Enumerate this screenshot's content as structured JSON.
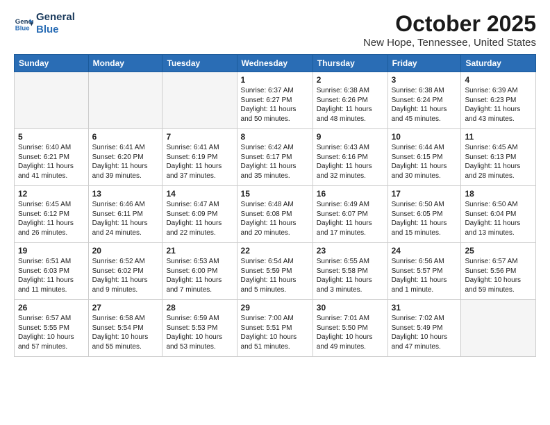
{
  "header": {
    "logo_line1": "General",
    "logo_line2": "Blue",
    "month": "October 2025",
    "location": "New Hope, Tennessee, United States"
  },
  "days_of_week": [
    "Sunday",
    "Monday",
    "Tuesday",
    "Wednesday",
    "Thursday",
    "Friday",
    "Saturday"
  ],
  "weeks": [
    [
      {
        "day": "",
        "info": ""
      },
      {
        "day": "",
        "info": ""
      },
      {
        "day": "",
        "info": ""
      },
      {
        "day": "1",
        "info": "Sunrise: 6:37 AM\nSunset: 6:27 PM\nDaylight: 11 hours\nand 50 minutes."
      },
      {
        "day": "2",
        "info": "Sunrise: 6:38 AM\nSunset: 6:26 PM\nDaylight: 11 hours\nand 48 minutes."
      },
      {
        "day": "3",
        "info": "Sunrise: 6:38 AM\nSunset: 6:24 PM\nDaylight: 11 hours\nand 45 minutes."
      },
      {
        "day": "4",
        "info": "Sunrise: 6:39 AM\nSunset: 6:23 PM\nDaylight: 11 hours\nand 43 minutes."
      }
    ],
    [
      {
        "day": "5",
        "info": "Sunrise: 6:40 AM\nSunset: 6:21 PM\nDaylight: 11 hours\nand 41 minutes."
      },
      {
        "day": "6",
        "info": "Sunrise: 6:41 AM\nSunset: 6:20 PM\nDaylight: 11 hours\nand 39 minutes."
      },
      {
        "day": "7",
        "info": "Sunrise: 6:41 AM\nSunset: 6:19 PM\nDaylight: 11 hours\nand 37 minutes."
      },
      {
        "day": "8",
        "info": "Sunrise: 6:42 AM\nSunset: 6:17 PM\nDaylight: 11 hours\nand 35 minutes."
      },
      {
        "day": "9",
        "info": "Sunrise: 6:43 AM\nSunset: 6:16 PM\nDaylight: 11 hours\nand 32 minutes."
      },
      {
        "day": "10",
        "info": "Sunrise: 6:44 AM\nSunset: 6:15 PM\nDaylight: 11 hours\nand 30 minutes."
      },
      {
        "day": "11",
        "info": "Sunrise: 6:45 AM\nSunset: 6:13 PM\nDaylight: 11 hours\nand 28 minutes."
      }
    ],
    [
      {
        "day": "12",
        "info": "Sunrise: 6:45 AM\nSunset: 6:12 PM\nDaylight: 11 hours\nand 26 minutes."
      },
      {
        "day": "13",
        "info": "Sunrise: 6:46 AM\nSunset: 6:11 PM\nDaylight: 11 hours\nand 24 minutes."
      },
      {
        "day": "14",
        "info": "Sunrise: 6:47 AM\nSunset: 6:09 PM\nDaylight: 11 hours\nand 22 minutes."
      },
      {
        "day": "15",
        "info": "Sunrise: 6:48 AM\nSunset: 6:08 PM\nDaylight: 11 hours\nand 20 minutes."
      },
      {
        "day": "16",
        "info": "Sunrise: 6:49 AM\nSunset: 6:07 PM\nDaylight: 11 hours\nand 17 minutes."
      },
      {
        "day": "17",
        "info": "Sunrise: 6:50 AM\nSunset: 6:05 PM\nDaylight: 11 hours\nand 15 minutes."
      },
      {
        "day": "18",
        "info": "Sunrise: 6:50 AM\nSunset: 6:04 PM\nDaylight: 11 hours\nand 13 minutes."
      }
    ],
    [
      {
        "day": "19",
        "info": "Sunrise: 6:51 AM\nSunset: 6:03 PM\nDaylight: 11 hours\nand 11 minutes."
      },
      {
        "day": "20",
        "info": "Sunrise: 6:52 AM\nSunset: 6:02 PM\nDaylight: 11 hours\nand 9 minutes."
      },
      {
        "day": "21",
        "info": "Sunrise: 6:53 AM\nSunset: 6:00 PM\nDaylight: 11 hours\nand 7 minutes."
      },
      {
        "day": "22",
        "info": "Sunrise: 6:54 AM\nSunset: 5:59 PM\nDaylight: 11 hours\nand 5 minutes."
      },
      {
        "day": "23",
        "info": "Sunrise: 6:55 AM\nSunset: 5:58 PM\nDaylight: 11 hours\nand 3 minutes."
      },
      {
        "day": "24",
        "info": "Sunrise: 6:56 AM\nSunset: 5:57 PM\nDaylight: 11 hours\nand 1 minute."
      },
      {
        "day": "25",
        "info": "Sunrise: 6:57 AM\nSunset: 5:56 PM\nDaylight: 10 hours\nand 59 minutes."
      }
    ],
    [
      {
        "day": "26",
        "info": "Sunrise: 6:57 AM\nSunset: 5:55 PM\nDaylight: 10 hours\nand 57 minutes."
      },
      {
        "day": "27",
        "info": "Sunrise: 6:58 AM\nSunset: 5:54 PM\nDaylight: 10 hours\nand 55 minutes."
      },
      {
        "day": "28",
        "info": "Sunrise: 6:59 AM\nSunset: 5:53 PM\nDaylight: 10 hours\nand 53 minutes."
      },
      {
        "day": "29",
        "info": "Sunrise: 7:00 AM\nSunset: 5:51 PM\nDaylight: 10 hours\nand 51 minutes."
      },
      {
        "day": "30",
        "info": "Sunrise: 7:01 AM\nSunset: 5:50 PM\nDaylight: 10 hours\nand 49 minutes."
      },
      {
        "day": "31",
        "info": "Sunrise: 7:02 AM\nSunset: 5:49 PM\nDaylight: 10 hours\nand 47 minutes."
      },
      {
        "day": "",
        "info": ""
      }
    ]
  ]
}
